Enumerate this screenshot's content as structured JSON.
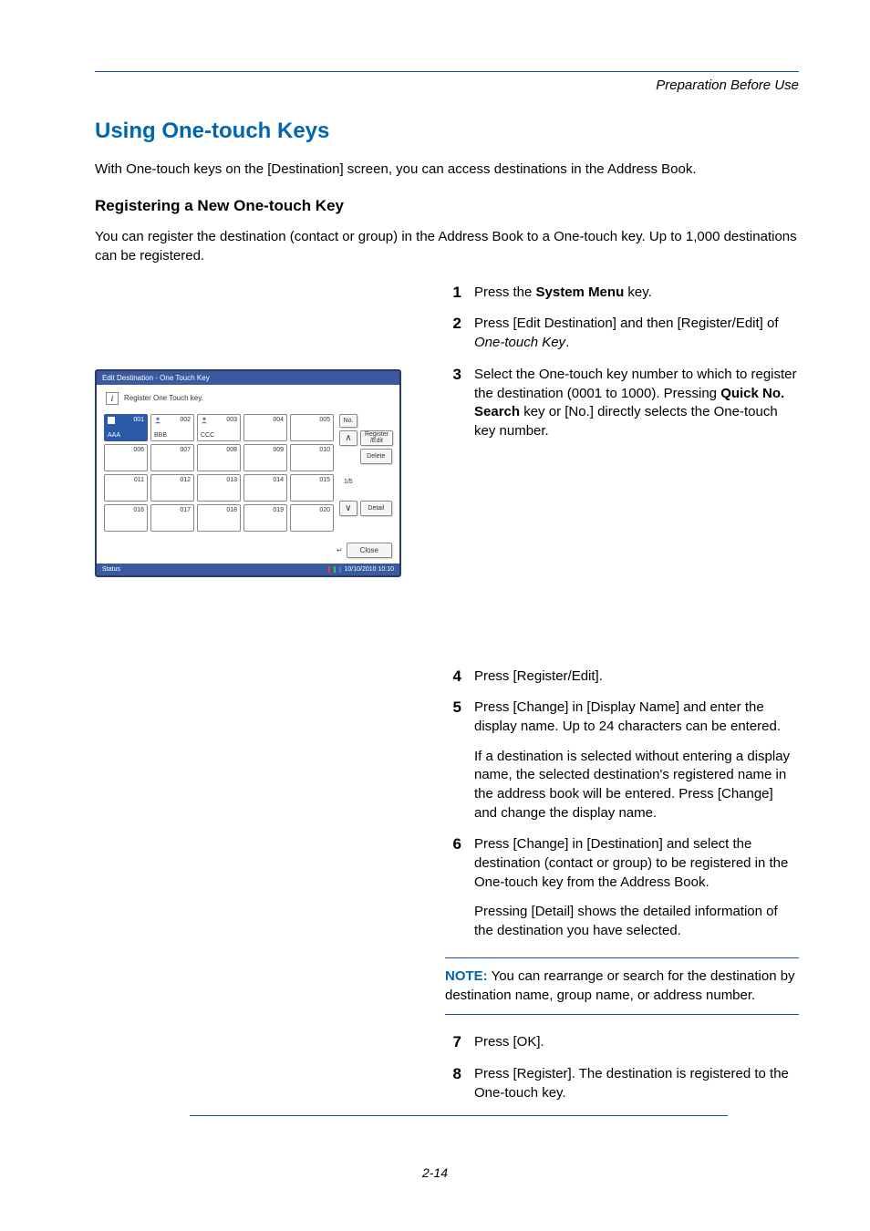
{
  "header": {
    "section": "Preparation Before Use"
  },
  "title": "Using One-touch Keys",
  "intro": "With One-touch keys on the [Destination] screen, you can access destinations in the Address Book.",
  "subtitle": "Registering a New One-touch Key",
  "subintro": "You can register the destination (contact or group) in the Address Book to a One-touch key. Up to 1,000 destinations can be registered.",
  "steps": {
    "s1": {
      "num": "1",
      "pre": "Press the ",
      "bold": "System Menu",
      "post": " key."
    },
    "s2": {
      "num": "2",
      "pre": "Press [Edit Destination] and then [Register/Edit] of ",
      "italic": "One-touch Key",
      "post": "."
    },
    "s3": {
      "num": "3",
      "pre": "Select the One-touch key number to which to register the destination (0001 to 1000). Pressing ",
      "bold": "Quick No. Search",
      "post": " key or [No.] directly selects the One-touch key number."
    },
    "s4": {
      "num": "4",
      "text": "Press [Register/Edit]."
    },
    "s5": {
      "num": "5",
      "p1": "Press [Change] in [Display Name] and enter the display name. Up to 24 characters can be entered.",
      "p2": "If a destination is selected without entering a display name, the selected destination's registered name in the address book will be entered. Press [Change] and change the display name."
    },
    "s6": {
      "num": "6",
      "p1": "Press [Change] in [Destination] and select the destination (contact or group) to be registered in the One-touch key from the Address Book.",
      "p2": "Pressing [Detail] shows the detailed information of the destination you have selected."
    },
    "s7": {
      "num": "7",
      "text": "Press [OK]."
    },
    "s8": {
      "num": "8",
      "text": "Press [Register]. The destination is registered to the One-touch key."
    }
  },
  "note": {
    "label": "NOTE:",
    "text": " You can rearrange or search for the destination by destination name, group name, or address number."
  },
  "footer": {
    "pagenum": "2-14"
  },
  "panel": {
    "title": "Edit Destination - One Touch Key",
    "header_text": "Register One Touch key.",
    "keys": {
      "k001": {
        "num": "001",
        "label": "AAA"
      },
      "k002": {
        "num": "002",
        "label": "BBB"
      },
      "k003": {
        "num": "003",
        "label": "CCC"
      },
      "k004": {
        "num": "004"
      },
      "k005": {
        "num": "005"
      },
      "k006": {
        "num": "006"
      },
      "k007": {
        "num": "007"
      },
      "k008": {
        "num": "008"
      },
      "k009": {
        "num": "009"
      },
      "k010": {
        "num": "010"
      },
      "k011": {
        "num": "011"
      },
      "k012": {
        "num": "012"
      },
      "k013": {
        "num": "013"
      },
      "k014": {
        "num": "014"
      },
      "k015": {
        "num": "015"
      },
      "k016": {
        "num": "016"
      },
      "k017": {
        "num": "017"
      },
      "k018": {
        "num": "018"
      },
      "k019": {
        "num": "019"
      },
      "k020": {
        "num": "020"
      }
    },
    "side": {
      "no": "No.",
      "register_edit": "Register /Edit",
      "delete": "Delete",
      "detail": "Detail",
      "page_indicator": "1/5",
      "up": "∧",
      "down": "∨"
    },
    "close": "Close",
    "status_left": "Status",
    "status_right": "10/10/2010   10:10"
  }
}
